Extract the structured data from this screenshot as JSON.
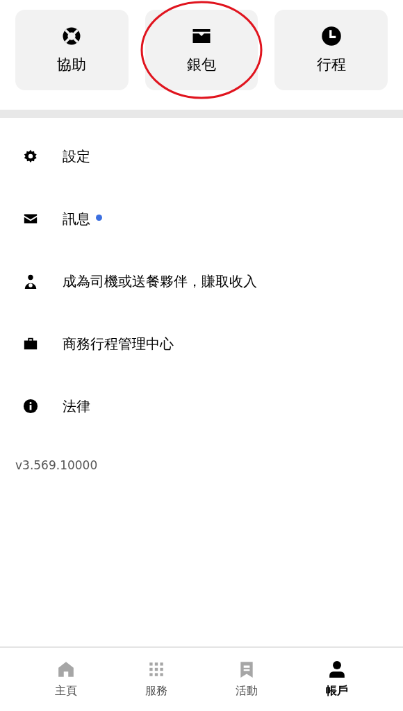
{
  "tiles": [
    {
      "label": "協助",
      "circled": false
    },
    {
      "label": "銀包",
      "circled": true
    },
    {
      "label": "行程",
      "circled": false
    }
  ],
  "menu": [
    {
      "label": "設定",
      "unread": false
    },
    {
      "label": "訊息",
      "unread": true
    },
    {
      "label": "成為司機或送餐夥伴，賺取收入",
      "unread": false
    },
    {
      "label": "商務行程管理中心",
      "unread": false
    },
    {
      "label": "法律",
      "unread": false
    }
  ],
  "version": "v3.569.10000",
  "bottom_nav": [
    {
      "label": "主頁",
      "selected": false
    },
    {
      "label": "服務",
      "selected": false
    },
    {
      "label": "活動",
      "selected": false
    },
    {
      "label": "帳戶",
      "selected": true
    }
  ]
}
